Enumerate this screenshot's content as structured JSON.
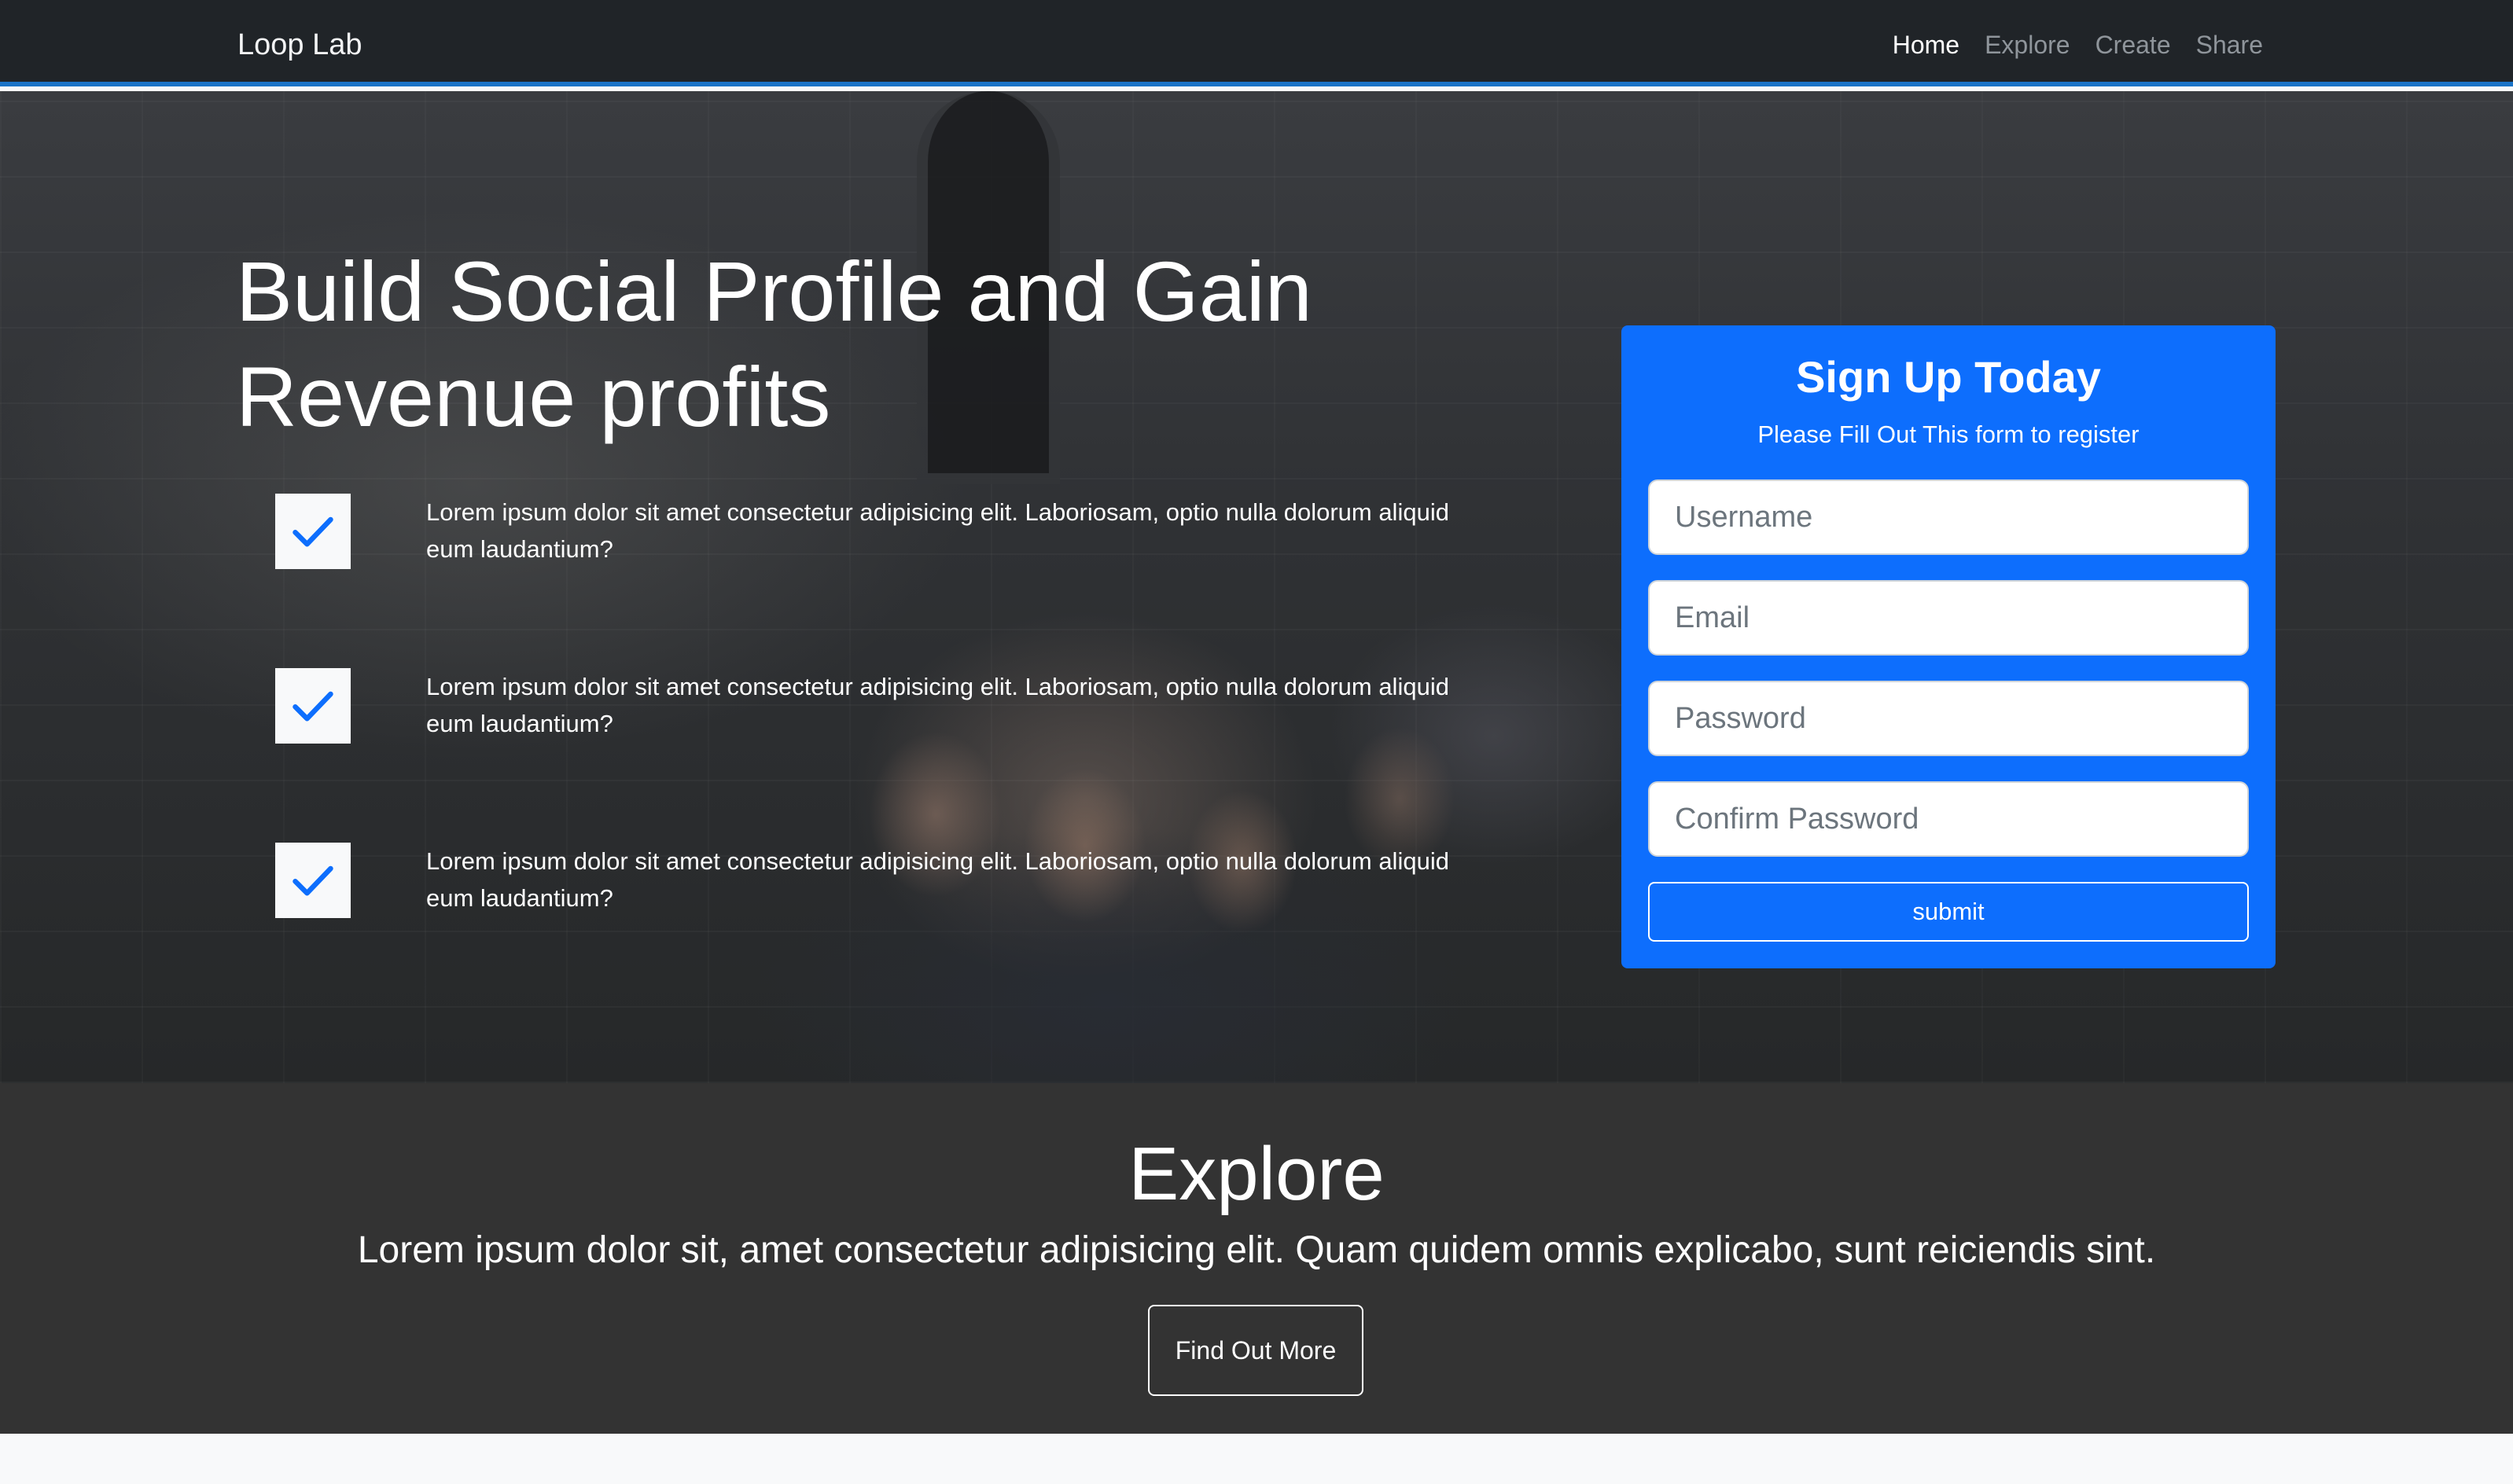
{
  "navbar": {
    "brand": "Loop Lab",
    "links": [
      {
        "label": "Home",
        "active": true
      },
      {
        "label": "Explore",
        "active": false
      },
      {
        "label": "Create",
        "active": false
      },
      {
        "label": "Share",
        "active": false
      }
    ]
  },
  "hero": {
    "headline": {
      "part1": "Build ",
      "part2": "Social Profile",
      "part3": " and Gain Revenue ",
      "part4": "profits"
    },
    "features": [
      {
        "icon": "check-icon",
        "text": "Lorem ipsum dolor sit amet consectetur adipisicing elit. Laboriosam, optio nulla dolorum aliquid eum laudantium?"
      },
      {
        "icon": "check-icon",
        "text": "Lorem ipsum dolor sit amet consectetur adipisicing elit. Laboriosam, optio nulla dolorum aliquid eum laudantium?"
      },
      {
        "icon": "check-icon",
        "text": "Lorem ipsum dolor sit amet consectetur adipisicing elit. Laboriosam, optio nulla dolorum aliquid eum laudantium?"
      }
    ]
  },
  "signup": {
    "title": "Sign Up Today",
    "subtitle": "Please Fill Out This form to register",
    "fields": [
      {
        "placeholder": "Username",
        "value": ""
      },
      {
        "placeholder": "Email",
        "value": ""
      },
      {
        "placeholder": "Password",
        "value": ""
      },
      {
        "placeholder": "Confirm Password",
        "value": ""
      }
    ],
    "submit_label": "submit"
  },
  "explore": {
    "title": "Explore",
    "text": "Lorem ipsum dolor sit, amet consectetur adipisicing elit. Quam quidem omnis explicabo, sunt reiciendis sint.",
    "button_label": "Find Out More"
  },
  "colors": {
    "primary": "#0d6efd",
    "navbar": "#202428",
    "nav_border": "#1a73c7",
    "explore_bg": "#333333"
  }
}
